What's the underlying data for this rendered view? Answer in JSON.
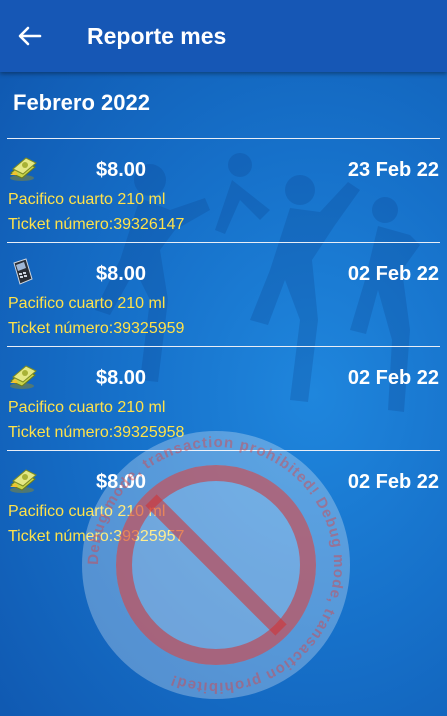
{
  "appbar": {
    "title": "Reporte mes",
    "back_icon": "arrow-left-icon"
  },
  "month_header": "Febrero 2022",
  "transactions": [
    {
      "icon": "cash-icon",
      "amount": "$8.00",
      "date": "23 Feb 22",
      "product": "Pacifico cuarto 210 ml",
      "ticket": "Ticket número:39326147"
    },
    {
      "icon": "card-terminal-icon",
      "amount": "$8.00",
      "date": "02 Feb 22",
      "product": "Pacifico cuarto 210 ml",
      "ticket": "Ticket número:39325959"
    },
    {
      "icon": "cash-icon",
      "amount": "$8.00",
      "date": "02 Feb 22",
      "product": "Pacifico cuarto 210 ml",
      "ticket": "Ticket número:39325958"
    },
    {
      "icon": "cash-icon",
      "amount": "$8.00",
      "date": "02 Feb 22",
      "product": "Pacifico cuarto 210 ml",
      "ticket": "Ticket número:39325957"
    }
  ],
  "watermark": {
    "text": "Debug mode, transaction prohibited! Debug mode, transaction prohibited!",
    "icon": "prohibited-icon",
    "color": "#d32f2f"
  },
  "colors": {
    "appbar": "#1657b5",
    "background": "#1670c9",
    "accent_text": "#ffe24a"
  }
}
